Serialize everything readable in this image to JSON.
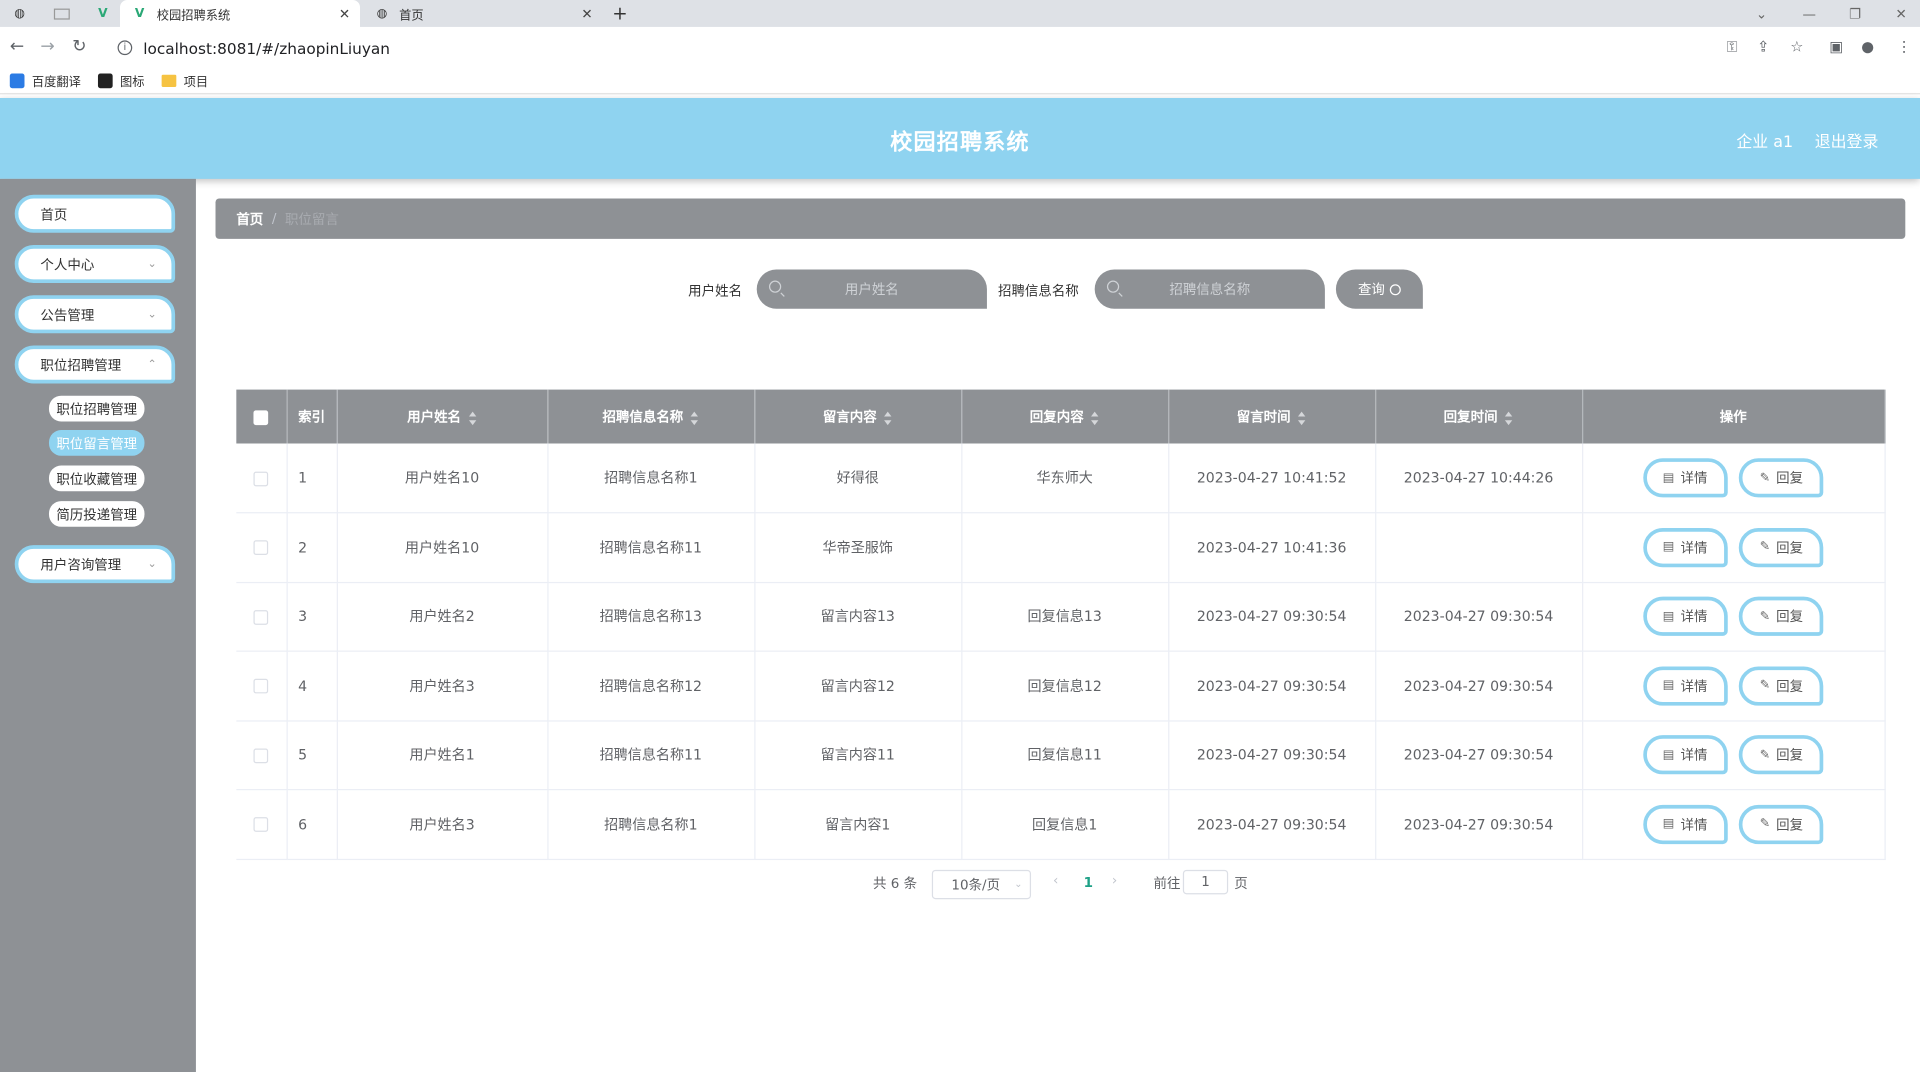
{
  "browser": {
    "tabs": [
      {
        "label": ""
      },
      {
        "label": ""
      },
      {
        "label": ""
      },
      {
        "label": "校园招聘系统"
      },
      {
        "label": "首页"
      }
    ],
    "url": "localhost:8081/#/zhaopinLiuyan",
    "bookmarks": [
      "百度翻译",
      "图标",
      "项目"
    ]
  },
  "header": {
    "title": "校园招聘系统",
    "user": "企业 a1",
    "logout": "退出登录"
  },
  "sidebar": {
    "items": [
      {
        "label": "首页"
      },
      {
        "label": "个人中心"
      },
      {
        "label": "公告管理"
      },
      {
        "label": "职位招聘管理"
      },
      {
        "label": "用户咨询管理"
      }
    ],
    "subitems": [
      {
        "label": "职位招聘管理"
      },
      {
        "label": "职位留言管理"
      },
      {
        "label": "职位收藏管理"
      },
      {
        "label": "简历投递管理"
      }
    ]
  },
  "breadcrumb": {
    "home": "首页",
    "current": "职位留言"
  },
  "search": {
    "user_label": "用户姓名",
    "user_placeholder": "用户姓名",
    "job_label": "招聘信息名称",
    "job_placeholder": "招聘信息名称",
    "button": "查询"
  },
  "table": {
    "headers": [
      "索引",
      "用户姓名",
      "招聘信息名称",
      "留言内容",
      "回复内容",
      "留言时间",
      "回复时间",
      "操作"
    ],
    "rows": [
      {
        "idx": "1",
        "user": "用户姓名10",
        "job": "招聘信息名称1",
        "content": "好得很",
        "reply": "华东师大",
        "time": "2023-04-27 10:41:52",
        "rtime": "2023-04-27 10:44:26"
      },
      {
        "idx": "2",
        "user": "用户姓名10",
        "job": "招聘信息名称11",
        "content": "华帝圣服饰",
        "reply": "",
        "time": "2023-04-27 10:41:36",
        "rtime": ""
      },
      {
        "idx": "3",
        "user": "用户姓名2",
        "job": "招聘信息名称13",
        "content": "留言内容13",
        "reply": "回复信息13",
        "time": "2023-04-27 09:30:54",
        "rtime": "2023-04-27 09:30:54"
      },
      {
        "idx": "4",
        "user": "用户姓名3",
        "job": "招聘信息名称12",
        "content": "留言内容12",
        "reply": "回复信息12",
        "time": "2023-04-27 09:30:54",
        "rtime": "2023-04-27 09:30:54"
      },
      {
        "idx": "5",
        "user": "用户姓名1",
        "job": "招聘信息名称11",
        "content": "留言内容11",
        "reply": "回复信息11",
        "time": "2023-04-27 09:30:54",
        "rtime": "2023-04-27 09:30:54"
      },
      {
        "idx": "6",
        "user": "用户姓名3",
        "job": "招聘信息名称1",
        "content": "留言内容1",
        "reply": "回复信息1",
        "time": "2023-04-27 09:30:54",
        "rtime": "2023-04-27 09:30:54"
      }
    ],
    "detail_label": "详情",
    "reply_label": "回复"
  },
  "pagination": {
    "total": "共 6 条",
    "size": "10条/页",
    "current": "1",
    "goto": "前往",
    "page_input": "1",
    "page_unit": "页"
  },
  "colors": {
    "accent": "#8fd3f0",
    "sidebar": "#8e9195",
    "pager_active": "#1fa187"
  }
}
